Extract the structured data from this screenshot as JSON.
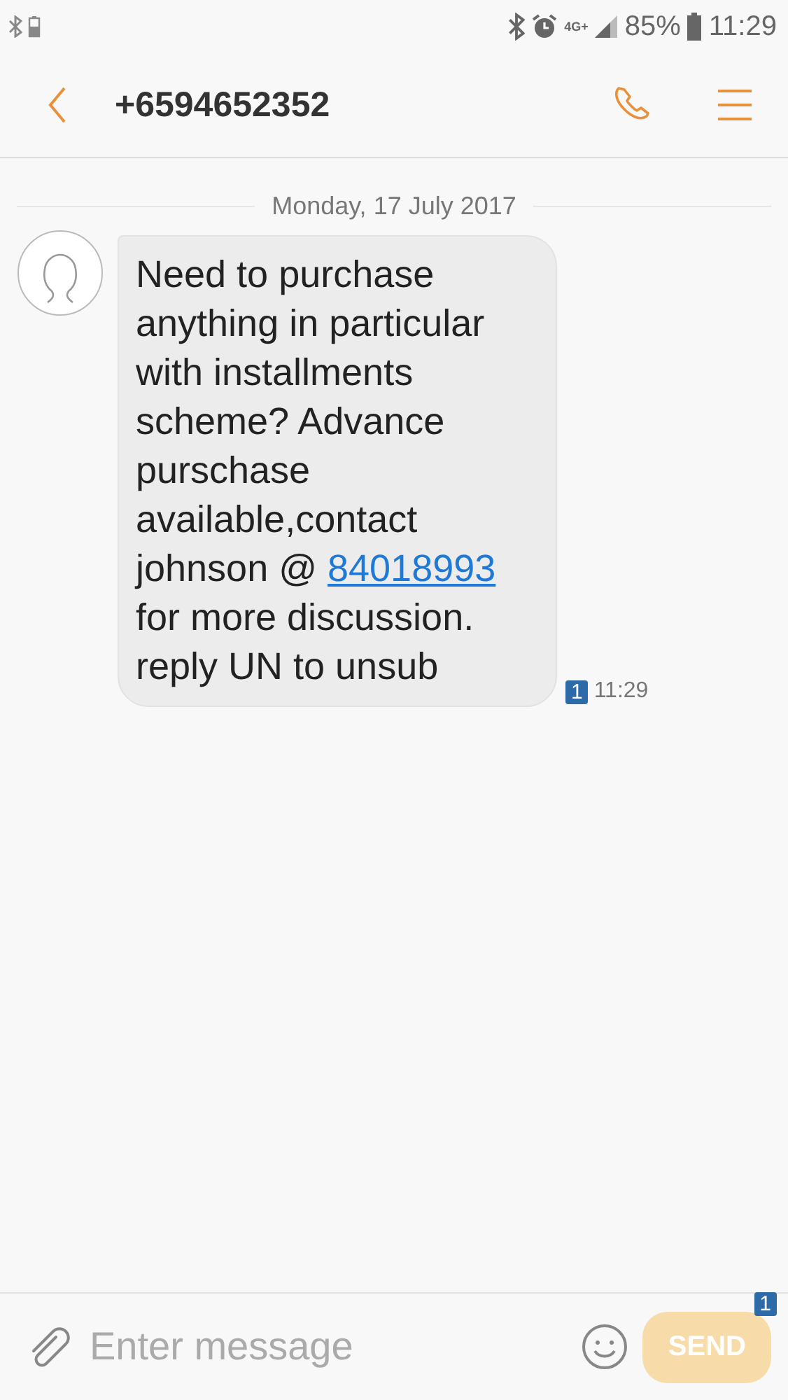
{
  "status_bar": {
    "network": "4G+",
    "battery": "85%",
    "time": "11:29"
  },
  "header": {
    "title": "+6594652352"
  },
  "date_separator": "Monday, 17 July 2017",
  "message": {
    "text_before": "Need to purchase anything in particular with installments scheme? Advance purschase available,contact johnson @ ",
    "link": "84018993",
    "text_after": " for more discussion. reply UN to unsub",
    "sim": "1",
    "time": "11:29"
  },
  "composer": {
    "placeholder": "Enter message",
    "send": "SEND",
    "sim": "1"
  }
}
